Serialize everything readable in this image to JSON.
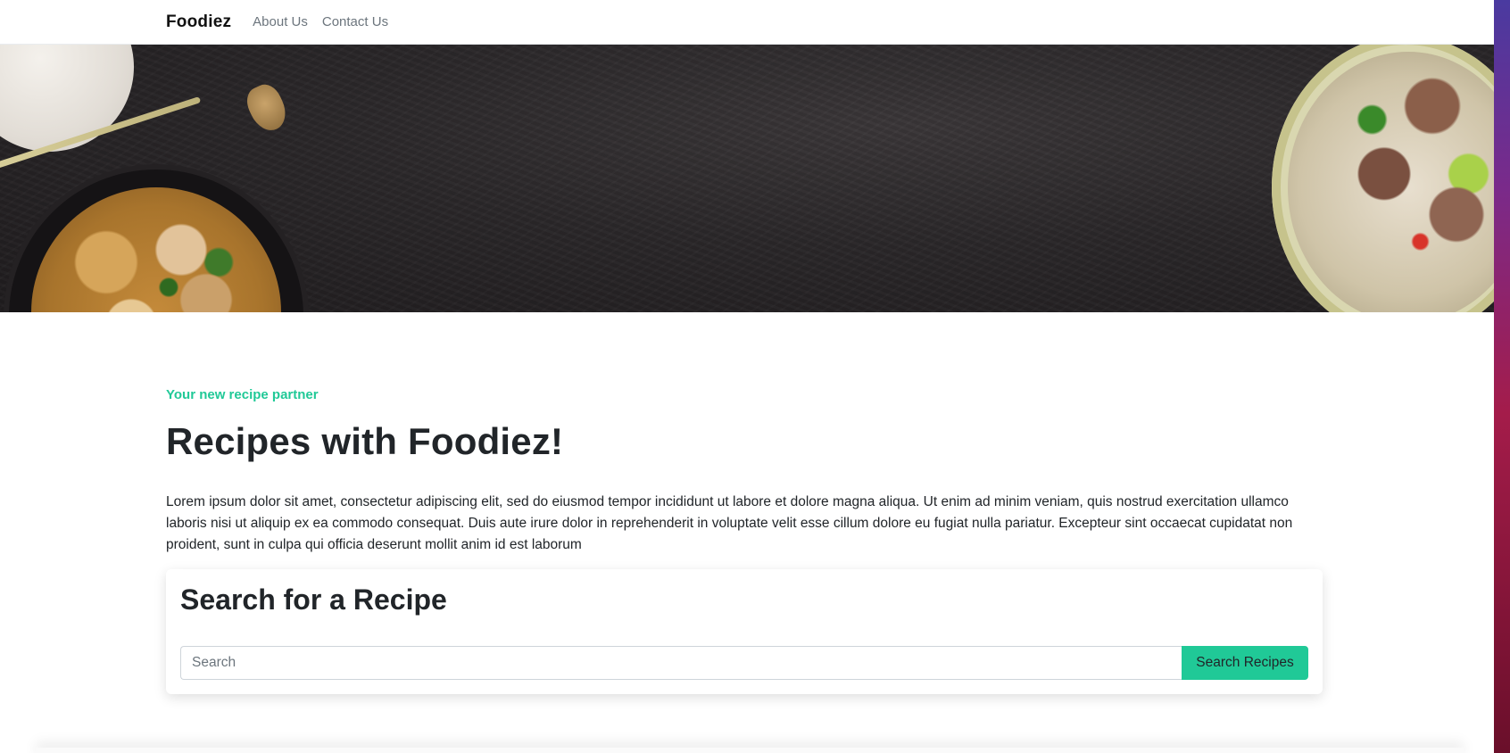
{
  "navbar": {
    "brand": "Foodiez",
    "links": [
      {
        "label": "About Us"
      },
      {
        "label": "Contact Us"
      }
    ]
  },
  "hero": {
    "image_alt": "Dark stone surface with bowls of pad thai and pho"
  },
  "intro": {
    "eyebrow": "Your new recipe partner",
    "headline": "Recipes with Foodiez!",
    "body": "Lorem ipsum dolor sit amet, consectetur adipiscing elit, sed do eiusmod tempor incididunt ut labore et dolore magna aliqua. Ut enim ad minim veniam, quis nostrud exercitation ullamco laboris nisi ut aliquip ex ea commodo consequat. Duis aute irure dolor in reprehenderit in voluptate velit esse cillum dolore eu fugiat nulla pariatur. Excepteur sint occaecat cupidatat non proident, sunt in culpa qui officia deserunt mollit anim id est laborum"
  },
  "search": {
    "title": "Search for a Recipe",
    "placeholder": "Search",
    "value": "",
    "button_label": "Search Recipes"
  },
  "colors": {
    "accent": "#20c997",
    "text": "#212529",
    "muted": "#6c757d"
  }
}
